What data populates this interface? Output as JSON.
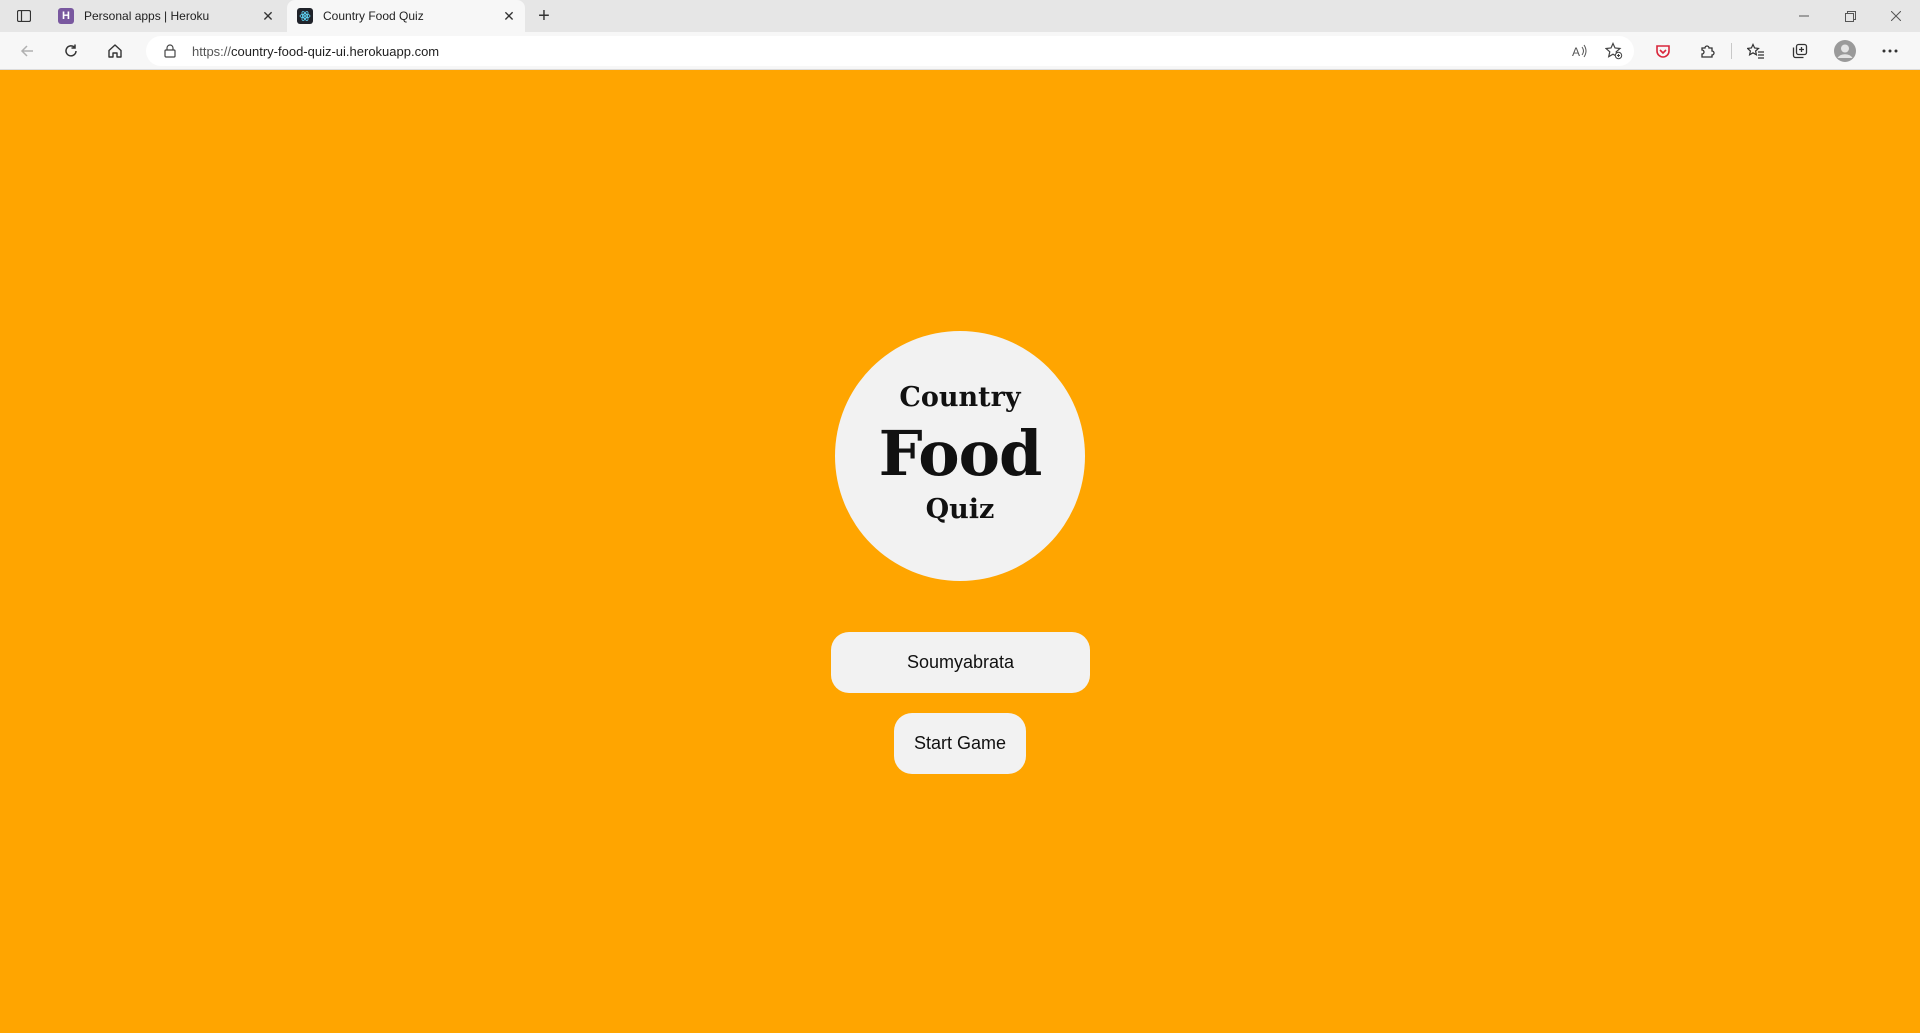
{
  "browser": {
    "tabs": [
      {
        "title": "Personal apps | Heroku",
        "favicon_color": "#79589F",
        "favicon_letter": "H"
      },
      {
        "title": "Country Food Quiz",
        "favicon_color": "#20232a"
      }
    ],
    "address": {
      "scheme": "https://",
      "host": "country-food-quiz-ui.herokuapp.com"
    }
  },
  "app": {
    "logo": {
      "line1": "Country",
      "line2": "Food",
      "line3": "Quiz"
    },
    "name_input_value": "Soumyabrata",
    "start_button_label": "Start Game",
    "background_color": "#FFA500",
    "panel_color": "#f2f2f2"
  }
}
